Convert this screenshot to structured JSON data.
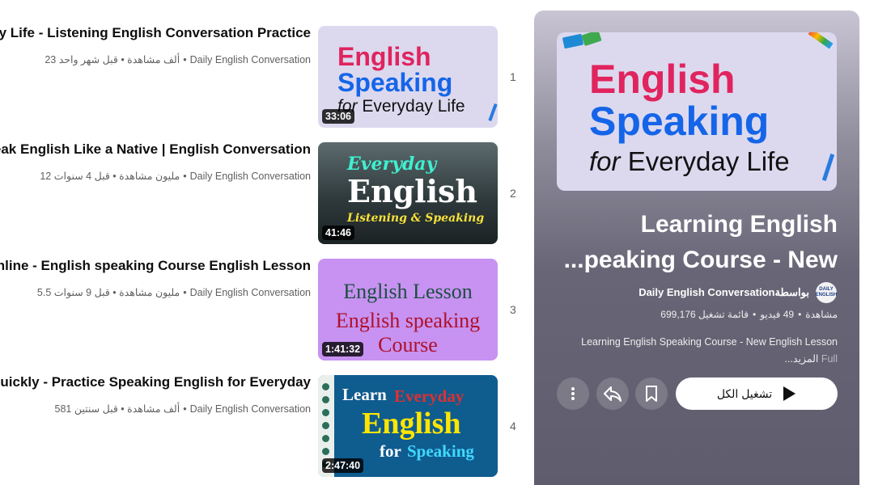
{
  "videos": [
    {
      "index": "1",
      "title": "ay Life - Listening English Conversation Practice",
      "channel": "Daily English Conversation",
      "stats": "23 ألف مشاهدة • قبل شهر واحد",
      "duration": "33:06",
      "thumb": {
        "line1": "English",
        "line2": "Speaking",
        "line3a": "for",
        "line3b": "Everyday Life"
      }
    },
    {
      "index": "2",
      "title": "eak English Like a Native | English Conversation",
      "channel": "Daily English Conversation",
      "stats": "12 مليون مشاهدة • قبل 4 سنوات",
      "duration": "41:46",
      "thumb": {
        "line1": "Everyday",
        "line2": "English",
        "line3": "Listening & Speaking"
      }
    },
    {
      "index": "3",
      "title": "Online - English speaking Course English Lesson",
      "channel": "Daily English Conversation",
      "stats": "5.5 مليون مشاهدة • قبل 9 سنوات",
      "duration": "1:41:32",
      "thumb": {
        "line1": "English Lesson",
        "line2": "English speaking Course"
      }
    },
    {
      "index": "4",
      "title": "Quickly - Practice Speaking English for Everyday",
      "channel": "Daily English Conversation",
      "stats": "581 ألف مشاهدة • قبل سنتين",
      "duration": "2:47:40",
      "thumb": {
        "line1a": "Learn",
        "line1b": "Everyday",
        "line2": "English",
        "line3a": "for",
        "line3b": "Speaking"
      }
    }
  ],
  "playlist": {
    "cover": {
      "line1": "English",
      "line2": "Speaking",
      "line3a": "for",
      "line3b": "Everyday Life"
    },
    "title_line1": "Learning English",
    "title_line2": "...peaking Course - New",
    "owner_prefix": "بواسطة",
    "owner_name": "Daily English Conversation",
    "avatar_text": "DAILY ENGLISH",
    "type": "قائمة تشغيل",
    "video_count": "49 فيديو",
    "views": "699,176 مشاهدة",
    "description": "Learning English Speaking Course - New English Lesson",
    "desc_full": "Full",
    "desc_more": "...المزيد",
    "play_all": "تشغيل الكل"
  },
  "icons": {
    "more": "more-vert-icon",
    "share": "share-icon",
    "save": "bookmark-icon",
    "play": "play-icon"
  },
  "colors": {
    "accent_pink": "#e0245e",
    "accent_blue": "#1565e8",
    "panel_bg": "#686676"
  }
}
